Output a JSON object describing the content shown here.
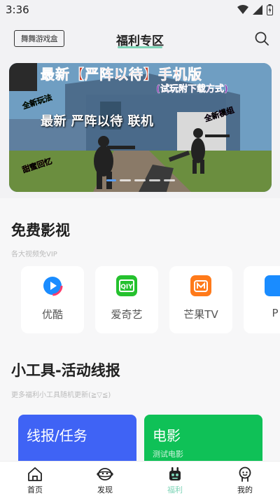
{
  "status": {
    "time": "3:36"
  },
  "header": {
    "brand": "舞舞游戏盒",
    "title": "福利专区"
  },
  "banner": {
    "headline": "最新 严阵以待 联机",
    "top_text": "最新【严阵以待】手机版",
    "sub_text": "(试玩附下载方式)",
    "stamp_left": "全新玩法",
    "stamp_right": "全新模组",
    "stamp_bottom": "甜蜜回忆",
    "slide_count": 5,
    "active_slide": 1
  },
  "free_video": {
    "title": "免费影视",
    "subtitle": "各大视频免VIP",
    "apps": [
      {
        "label": "优酷",
        "icon": "youku-icon",
        "color": "#1a8cff"
      },
      {
        "label": "爱奇艺",
        "icon": "iqiyi-icon",
        "color": "#25c12e"
      },
      {
        "label": "芒果TV",
        "icon": "mango-tv-icon",
        "color": "#ff7a1a"
      },
      {
        "label": "P",
        "icon": "pptv-icon",
        "color": "#1a8cff"
      }
    ]
  },
  "tools": {
    "title": "小工具-活动线报",
    "subtitle": "更多福利小工具随机更新(≧▽≦)",
    "tiles": [
      {
        "label": "线报/任务",
        "color": "#3f63f5"
      },
      {
        "label": "电影",
        "sub": "测试电影",
        "color": "#0fc157"
      }
    ]
  },
  "tabs": [
    {
      "label": "首页",
      "icon": "home-icon"
    },
    {
      "label": "发现",
      "icon": "discover-icon"
    },
    {
      "label": "福利",
      "icon": "gift-icon",
      "active": true
    },
    {
      "label": "我的",
      "icon": "profile-icon"
    }
  ],
  "theme": {
    "accent": "#7ed4b7"
  }
}
